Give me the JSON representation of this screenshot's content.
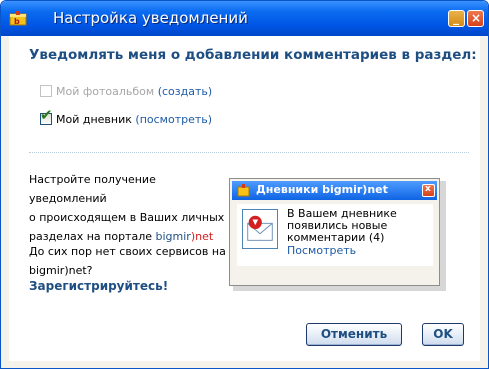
{
  "window": {
    "title": "Настройка уведомлений",
    "minimize_glyph": "_",
    "close_glyph": "×"
  },
  "heading": "Уведомлять меня о добавлении комментариев в раздел:",
  "options": [
    {
      "label": "Мой фотоальбом",
      "link": "(создать)",
      "checked": false,
      "enabled": false
    },
    {
      "label": "Мой дневник",
      "link": "(посмотреть)",
      "checked": true,
      "enabled": true
    }
  ],
  "info": {
    "line1": "Настройте получение уведомлений",
    "line2": "о происходящем в Ваших личных",
    "line3_prefix": "разделах на портале ",
    "brand_a": "bigmir",
    "brand_b": ")net",
    "question_line1": "До сих пор нет своих сервисов на",
    "question_line2": "bigmir)net?",
    "register_link": "Зарегистрируйтесь!"
  },
  "notification": {
    "title": "Дневники bigmir)net",
    "close_glyph": "x",
    "message_line1": "В Вашем дневнике",
    "message_line2": "появились новые",
    "message_line3": "комментарии (4)",
    "link": "Посмотреть"
  },
  "buttons": {
    "cancel": "Отменить",
    "ok": "OK"
  },
  "colors": {
    "titlebar": "#0055e5",
    "heading": "#1f4f82",
    "link": "#1d5aa6",
    "brand_red": "#d42020"
  }
}
